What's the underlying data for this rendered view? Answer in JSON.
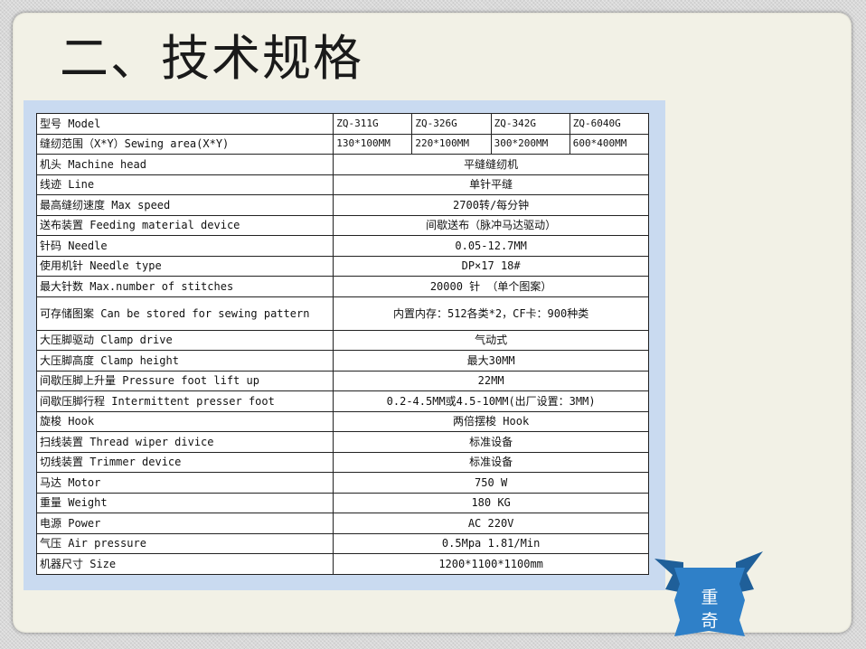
{
  "title": "二、技术规格",
  "table": {
    "header": {
      "label": "型号 Model",
      "models": [
        "ZQ-311G",
        "ZQ-326G",
        "ZQ-342G",
        "ZQ-6040G"
      ]
    },
    "area_row": {
      "label": "缝纫范围（X*Y）Sewing area(X*Y)",
      "values": [
        "130*100MM",
        "220*100MM",
        "300*200MM",
        "600*400MM"
      ]
    },
    "rows": [
      {
        "label": "机头 Machine head",
        "value": "平缝缝纫机"
      },
      {
        "label": "线迹 Line",
        "value": "单针平缝"
      },
      {
        "label": "最高缝纫速度 Max speed",
        "value": "2700转/每分钟"
      },
      {
        "label": "送布装置 Feeding material device",
        "value": "间歇送布（脉冲马达驱动）"
      },
      {
        "label": "针码 Needle",
        "value": "0.05-12.7MM"
      },
      {
        "label": "使用机针 Needle type",
        "value": "DP×17 18#"
      },
      {
        "label": "最大针数 Max.number of stitches",
        "value": "20000 针 （单个图案）"
      },
      {
        "label": "可存储图案 Can be stored for sewing pattern",
        "value": "内置内存：512各类*2，CF卡：900种类"
      },
      {
        "label": "大压脚驱动 Clamp drive",
        "value": "气动式"
      },
      {
        "label": "大压脚高度 Clamp height",
        "value": "最大30MM"
      },
      {
        "label": "间歇压脚上升量 Pressure foot lift up",
        "value": "22MM"
      },
      {
        "label": "间歇压脚行程 Intermittent presser foot",
        "value": "0.2-4.5MM或4.5-10MM(出厂设置：3MM)"
      },
      {
        "label": "旋梭 Hook",
        "value": "两倍摆梭 Hook"
      },
      {
        "label": "扫线装置 Thread wiper divice",
        "value": "标准设备"
      },
      {
        "label": "切线装置 Trimmer device",
        "value": "标准设备"
      },
      {
        "label": "马达 Motor",
        "value": "750 W"
      },
      {
        "label": "重量 Weight",
        "value": "180 KG"
      },
      {
        "label": "电源 Power",
        "value": "AC 220V"
      },
      {
        "label": "气压 Air pressure",
        "value": "0.5Mpa 1.81/Min"
      },
      {
        "label": "机器尺寸 Size",
        "value": "1200*1100*1100mm"
      }
    ]
  },
  "ribbon": {
    "line1": "重",
    "line2": "奇",
    "color": "#2f80c8"
  }
}
